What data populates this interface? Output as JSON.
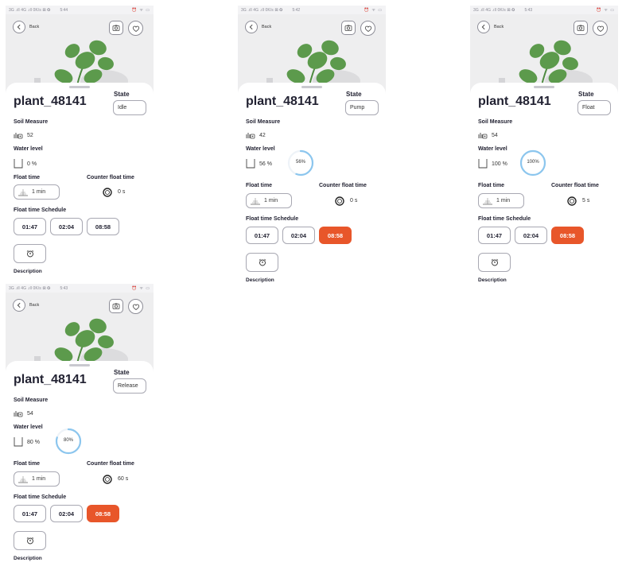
{
  "colors": {
    "accent": "#e8562a",
    "ring": "#8cc6ee",
    "plant": "#5c9a4c",
    "border": "#a8a8b2"
  },
  "screens": [
    {
      "status": {
        "left": "3G .ıll 4G .ıll 0K/s ⊠ ✪",
        "time": "5:44",
        "right": "⏰ ᯤ ▭"
      },
      "back_label": "Back",
      "plant_name": "plant_48141",
      "state_label": "State",
      "state_value": "Idle",
      "soil_title": "Soil Measure",
      "soil_value": "52",
      "water_title": "Water level",
      "water_value": "0 %",
      "water_percent": 0,
      "water_ring_visible": false,
      "float_title": "Float time",
      "float_value": "1 min",
      "counter_title": "Counter float time",
      "counter_value": "0 s",
      "schedule_title": "Float time Schedule",
      "schedule": [
        {
          "time": "01:47",
          "active": false
        },
        {
          "time": "02:04",
          "active": false
        },
        {
          "time": "08:58",
          "active": false
        }
      ],
      "description_title": "Description"
    },
    {
      "status": {
        "left": "3G .ıll 4G .ıll 0K/s ⊠ ✪",
        "time": "5:42",
        "right": "⏰ ᯤ ▭"
      },
      "back_label": "Back",
      "plant_name": "plant_48141",
      "state_label": "State",
      "state_value": "Pump",
      "soil_title": "Soil Measure",
      "soil_value": "42",
      "water_title": "Water level",
      "water_value": "56 %",
      "water_percent": 56,
      "water_ring_label": "56%",
      "water_ring_visible": true,
      "float_title": "Float time",
      "float_value": "1 min",
      "counter_title": "Counter float time",
      "counter_value": "0 s",
      "schedule_title": "Float time Schedule",
      "schedule": [
        {
          "time": "01:47",
          "active": false
        },
        {
          "time": "02:04",
          "active": false
        },
        {
          "time": "08:58",
          "active": true
        }
      ],
      "description_title": "Description"
    },
    {
      "status": {
        "left": "3G .ıll 4G .ıll 0K/s ⊠ ✪",
        "time": "5:43",
        "right": "⏰ ᯤ ▭"
      },
      "back_label": "Back",
      "plant_name": "plant_48141",
      "state_label": "State",
      "state_value": "Float",
      "soil_title": "Soil Measure",
      "soil_value": "54",
      "water_title": "Water level",
      "water_value": "100 %",
      "water_percent": 100,
      "water_ring_label": "100%",
      "water_ring_visible": true,
      "float_title": "Float time",
      "float_value": "1 min",
      "counter_title": "Counter float time",
      "counter_value": "5 s",
      "schedule_title": "Float time Schedule",
      "schedule": [
        {
          "time": "01:47",
          "active": false
        },
        {
          "time": "02:04",
          "active": false
        },
        {
          "time": "08:58",
          "active": true
        }
      ],
      "description_title": "Description"
    },
    {
      "status": {
        "left": "3G .ıll 4G .ıll 0K/s ⊠ ✪",
        "time": "5:43",
        "right": "⏰ ᯤ ▭"
      },
      "back_label": "Back",
      "plant_name": "plant_48141",
      "state_label": "State",
      "state_value": "Release",
      "soil_title": "Soil Measure",
      "soil_value": "54",
      "water_title": "Water level",
      "water_value": "80 %",
      "water_percent": 80,
      "water_ring_label": "80%",
      "water_ring_visible": true,
      "float_title": "Float time",
      "float_value": "1 min",
      "counter_title": "Counter float time",
      "counter_value": "60 s",
      "schedule_title": "Float time Schedule",
      "schedule": [
        {
          "time": "01:47",
          "active": false
        },
        {
          "time": "02:04",
          "active": false
        },
        {
          "time": "08:58",
          "active": true
        }
      ],
      "description_title": "Description"
    }
  ]
}
